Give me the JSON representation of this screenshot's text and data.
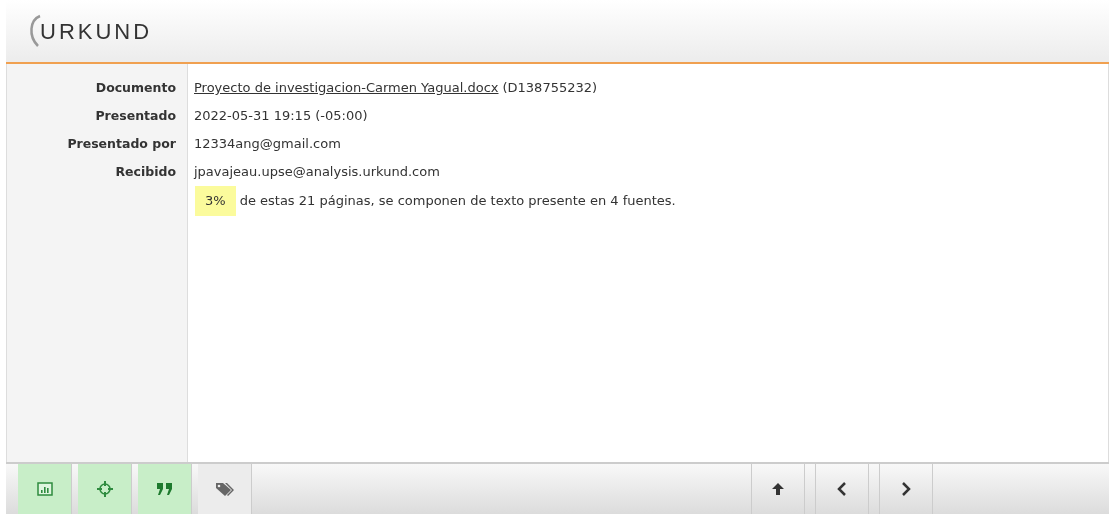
{
  "logo": "URKUND",
  "details": [
    {
      "label": "Documento",
      "kind": "link",
      "value": "Proyecto de investigacion-Carmen Yagual.docx",
      "extra": "(D138755232)"
    },
    {
      "label": "Presentado",
      "kind": "text",
      "value": "2022-05-31 19:15 (-05:00)"
    },
    {
      "label": "Presentado por",
      "kind": "text",
      "value": "12334ang@gmail.com"
    },
    {
      "label": "Recibido",
      "kind": "text",
      "value": "jpavajeau.upse@analysis.urkund.com"
    }
  ],
  "summary": {
    "percent": "3%",
    "text": "de estas 21 páginas, se componen de texto presente en 4 fuentes."
  },
  "toolbar": [
    {
      "kind": "chart",
      "on": true
    },
    {
      "kind": "target",
      "on": true
    },
    {
      "kind": "quote",
      "on": true
    },
    {
      "kind": "tags",
      "on": false
    }
  ],
  "navigation": [
    {
      "kind": "up"
    },
    {
      "kind": "prev"
    },
    {
      "kind": "next"
    }
  ]
}
